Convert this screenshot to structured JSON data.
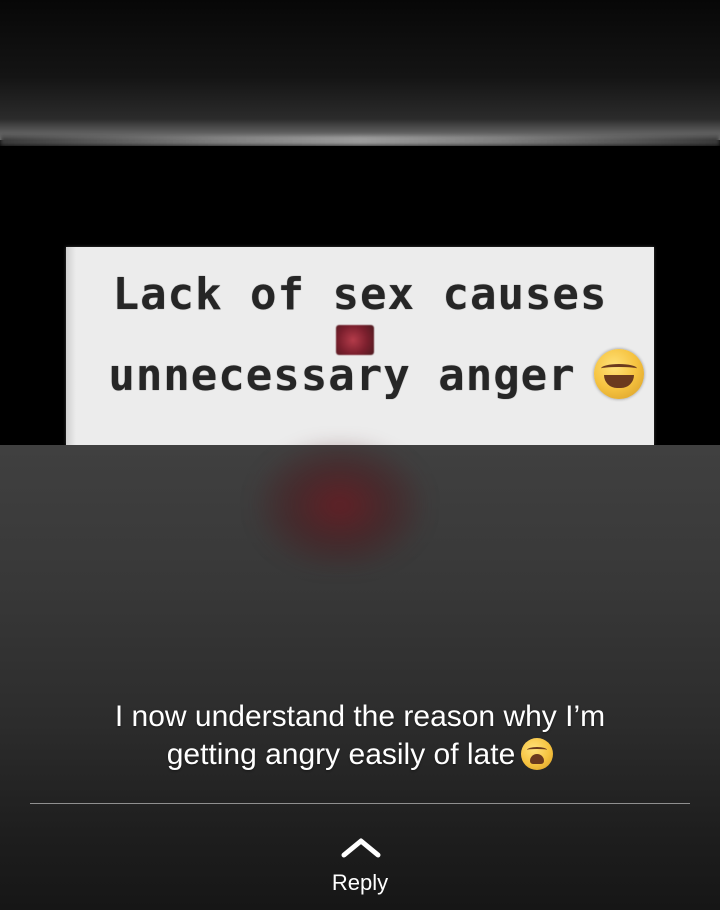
{
  "meme": {
    "line1": "Lack of sex causes",
    "line2": "unnecessary anger",
    "emoji_icon": "laughing-emoji-icon",
    "sticker_icon": "red-sticker-icon"
  },
  "caption": {
    "line1": "I now understand the reason why I’m",
    "line2": "getting angry easily of late",
    "emoji_icon": "weary-face-emoji-icon"
  },
  "reply": {
    "label": "Reply",
    "icon": "chevron-up-icon"
  },
  "colors": {
    "background": "#000000",
    "caption_text": "#ffffff",
    "meme_card": "#ececec",
    "meme_text": "#262626"
  }
}
